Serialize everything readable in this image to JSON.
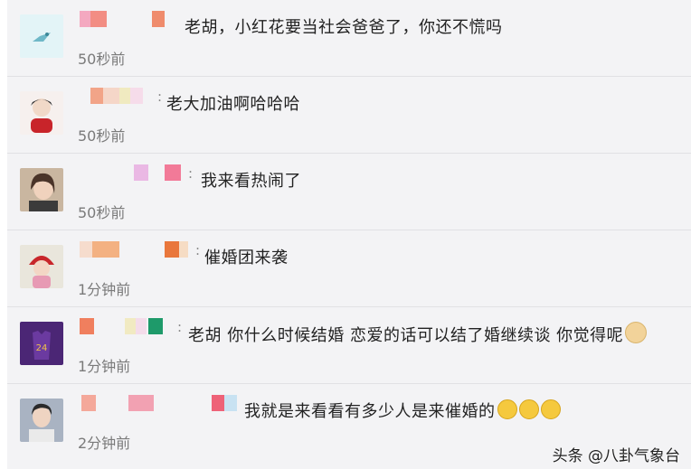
{
  "comments": [
    {
      "text": "老胡，小红花要当社会爸爸了，你还不慌吗",
      "time": "50秒前",
      "avatar": "bird-avatar"
    },
    {
      "text": "老大加油啊哈哈哈",
      "time": "50秒前",
      "avatar": "cartoon-avatar"
    },
    {
      "text": "我来看热闹了",
      "time": "50秒前",
      "avatar": "girl-avatar"
    },
    {
      "text": "催婚团来袭",
      "time": "1分钟前",
      "avatar": "doll-avatar"
    },
    {
      "text": "老胡 你什么时候结婚 恋爱的话可以结了婚继续谈 你觉得呢",
      "time": "1分钟前",
      "avatar": "jersey-avatar",
      "trailing_emoji": "doge-emoji"
    },
    {
      "text": "我就是来看看有多少人是来催婚的",
      "time": "2分钟前",
      "avatar": "boy-avatar",
      "trailing_emoji": "crying-laughing-emoji"
    }
  ],
  "separator": ":",
  "watermark": "头条 @八卦气象台",
  "colors": {
    "background": "#f3f3f5",
    "text": "#222222",
    "time": "#7a7a7a"
  }
}
